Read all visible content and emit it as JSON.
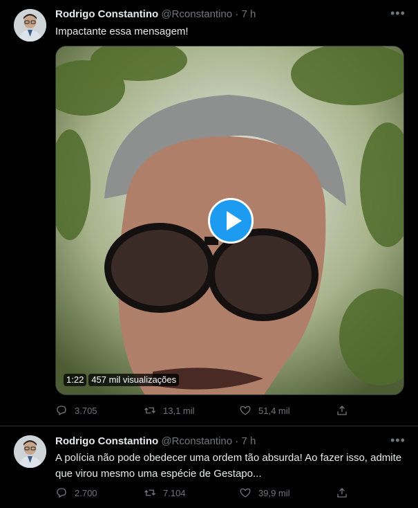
{
  "tweets": [
    {
      "author_name": "Rodrigo Constantino",
      "handle": "@Rconstantino",
      "separator": "·",
      "time": "7 h",
      "text": "Impactante essa mensagem!",
      "media": {
        "duration": "1:22",
        "views": "457 mil visualizações"
      },
      "stats": {
        "replies": "3.705",
        "retweets": "13,1 mil",
        "likes": "51,4 mil"
      }
    },
    {
      "author_name": "Rodrigo Constantino",
      "handle": "@Rconstantino",
      "separator": "·",
      "time": "7 h",
      "text": "A polícia não pode obedecer uma ordem tão absurda! Ao fazer isso, admite que virou mesmo uma espécie de Gestapo...",
      "stats": {
        "replies": "2.700",
        "retweets": "7.104",
        "likes": "39,9 mil"
      }
    }
  ],
  "icons": {
    "more": "more-horizontal-icon",
    "reply": "reply-icon",
    "retweet": "retweet-icon",
    "like": "heart-icon",
    "share": "share-icon",
    "play": "play-icon"
  },
  "colors": {
    "accent": "#1d9bf0",
    "background": "#000000",
    "muted": "#71767b",
    "text": "#e7e9ea"
  }
}
